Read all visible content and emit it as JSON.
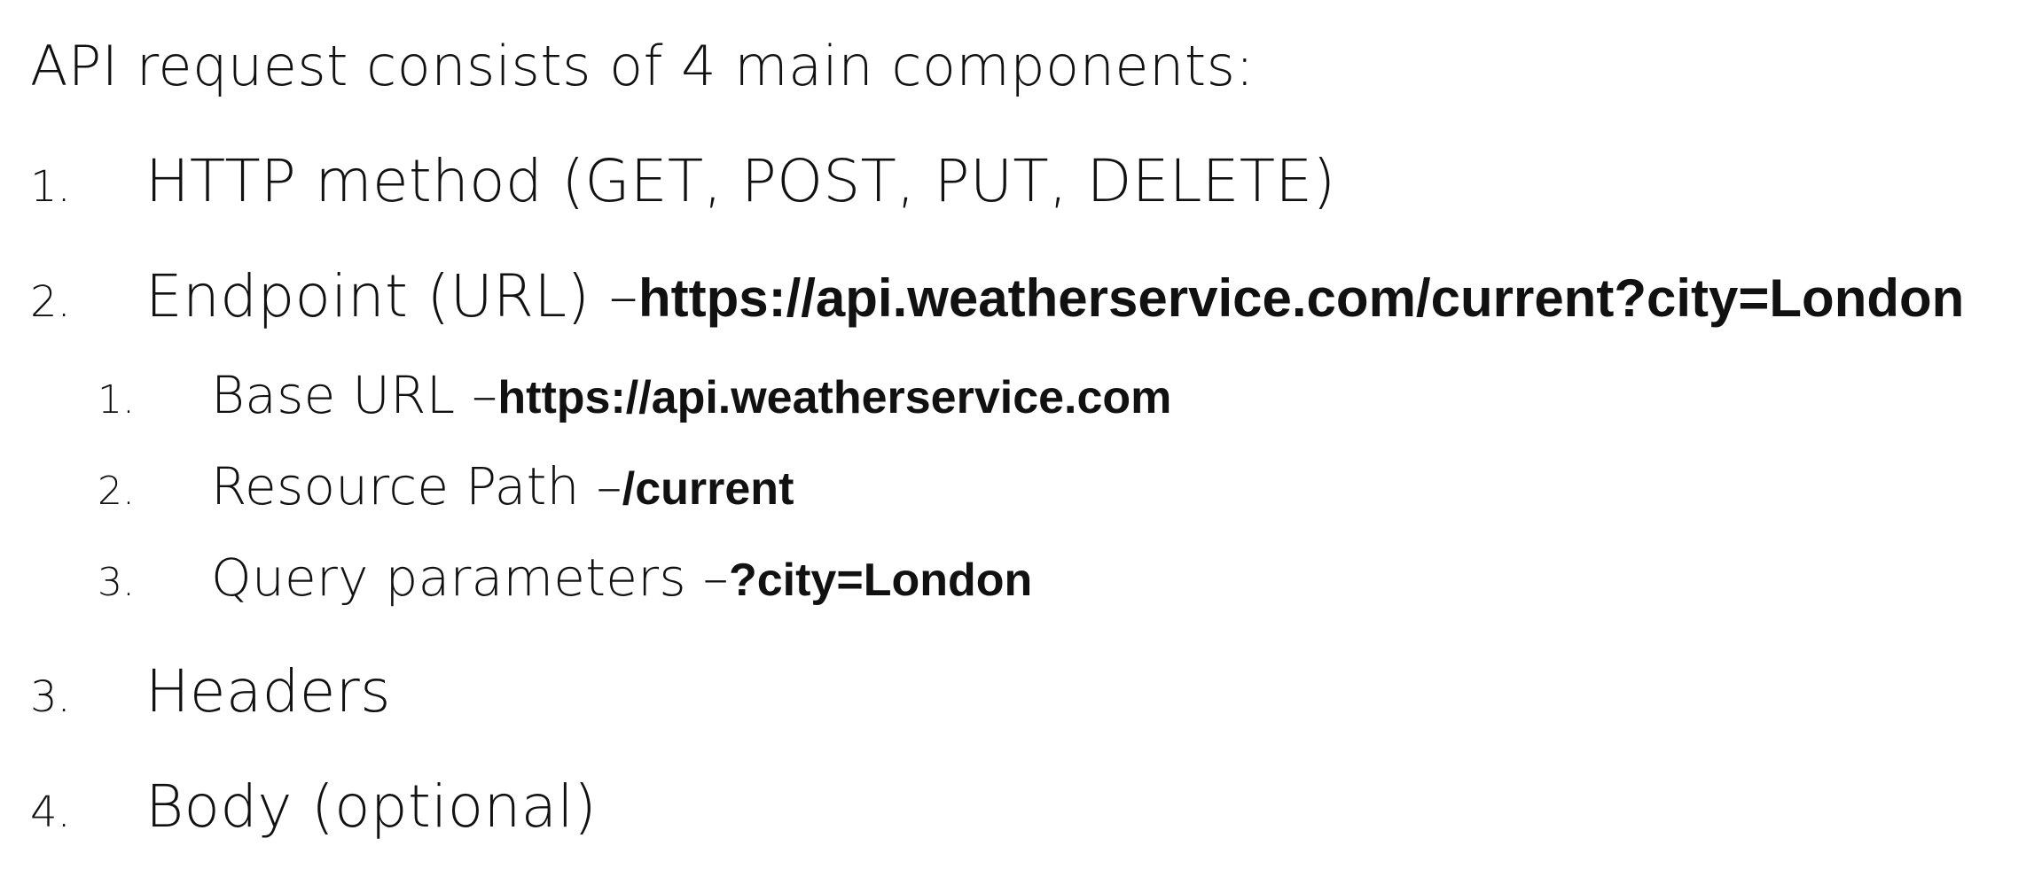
{
  "intro": "API request consists of 4 main components:",
  "items": [
    {
      "number": "1.",
      "label": "HTTP method (GET, POST, PUT, DELETE)",
      "value": ""
    },
    {
      "number": "2.",
      "label": "Endpoint (URL) – ",
      "value": "https://api.weatherservice.com/current?city=London",
      "subitems": [
        {
          "number": "1.",
          "label": "Base URL – ",
          "value": "https://api.weatherservice.com"
        },
        {
          "number": "2.",
          "label": "Resource Path – ",
          "value": "/current"
        },
        {
          "number": "3.",
          "label": "Query parameters – ",
          "value": "?city=London"
        }
      ]
    },
    {
      "number": "3.",
      "label": "Headers",
      "value": ""
    },
    {
      "number": "4.",
      "label": "Body (optional)",
      "value": ""
    }
  ]
}
